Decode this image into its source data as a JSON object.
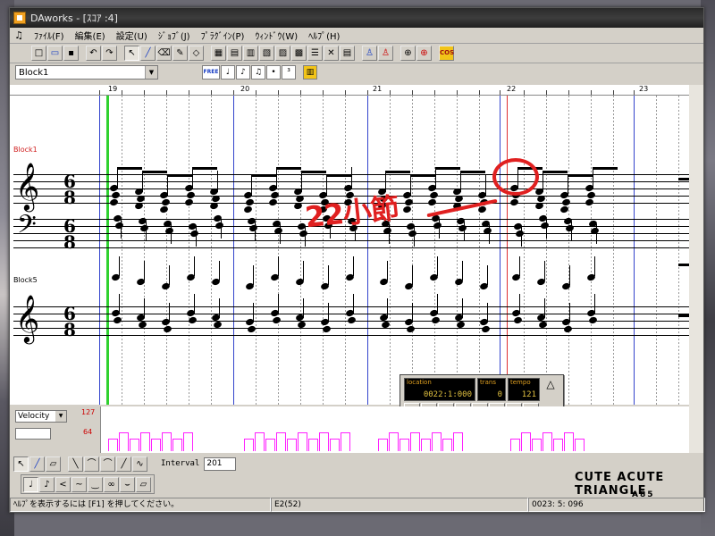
{
  "window": {
    "title": "DAworks - [ｽｺｱ :4]"
  },
  "menu": {
    "items": [
      "ﾌｧｲﾙ(F)",
      "編集(E)",
      "設定(U)",
      "ｼﾞｮﾌﾞ(J)",
      "ﾌﾟﾗｸﾞｲﾝ(P)",
      "ｳｨﾝﾄﾞｳ(W)",
      "ﾍﾙﾌﾟ(H)"
    ]
  },
  "toolbar": {
    "buttons": [
      "new",
      "open",
      "save",
      "undo",
      "redo",
      "select",
      "pen",
      "eraser",
      "pencil",
      "stamp",
      "grid1",
      "grid2",
      "grid3",
      "grid4",
      "grid5",
      "score-view",
      "track",
      "mixer",
      "mute",
      "solo",
      "metronome",
      "record",
      "cos"
    ]
  },
  "toolbar2": {
    "block_select": "Block1",
    "free_label": "FREE"
  },
  "ruler": {
    "measures": [
      "19",
      "20",
      "21",
      "22",
      "23"
    ]
  },
  "score": {
    "block_top": "Block1",
    "block_bottom": "Block5",
    "time_sig_top": "6",
    "time_sig_bottom": "8",
    "annotation": "22小節"
  },
  "transport": {
    "location_label": "location",
    "location_value": "0022:1:000",
    "trans_label": "trans",
    "trans_value": "0",
    "tempo_label": "tempo",
    "tempo_value": "121"
  },
  "velocity": {
    "selector": "Velocity",
    "max": "127",
    "mid": "64"
  },
  "tools": {
    "interval_label": "Interval",
    "interval_value": "201"
  },
  "status": {
    "help": "ﾍﾙﾌﾟを表示するには [F1] を押してください。",
    "note": "E2(52)",
    "position": "0023: 5: 096"
  },
  "signature": {
    "name": "CUTE ACUTE TRIANGLE",
    "sub": "A85"
  },
  "colors": {
    "bar_line": "#3344cc",
    "cursor": "#2fd12f",
    "velocity": "#ff20ff",
    "annotation": "#e02020"
  }
}
